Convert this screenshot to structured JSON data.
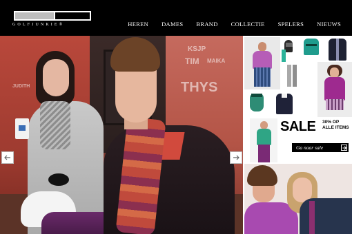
{
  "brand": {
    "logo_text": "GOLFJUNKIE",
    "logo_mark": "®"
  },
  "nav": {
    "items": [
      "HEREN",
      "DAMES",
      "BRAND",
      "COLLECTIE",
      "SPELERS",
      "NIEUWS"
    ]
  },
  "hero": {
    "graffiti": [
      "KSJP",
      "TIM",
      "MAIKA",
      "THYS",
      "JUDITH"
    ],
    "cup_logo": "blue-logo",
    "prev_icon": "arrow-left-icon",
    "next_icon": "arrow-right-icon"
  },
  "sale": {
    "headline": "SALE",
    "detail": "30% OP ALLE ITEMS",
    "button_label": "Ga naar sale",
    "button_icon": "arrow-right-icon"
  },
  "colors": {
    "header_bg": "#000000",
    "nav_text": "#ffffff",
    "sale_button_bg": "#000000",
    "purple": "#a84ab0",
    "teal": "#2fa585"
  }
}
